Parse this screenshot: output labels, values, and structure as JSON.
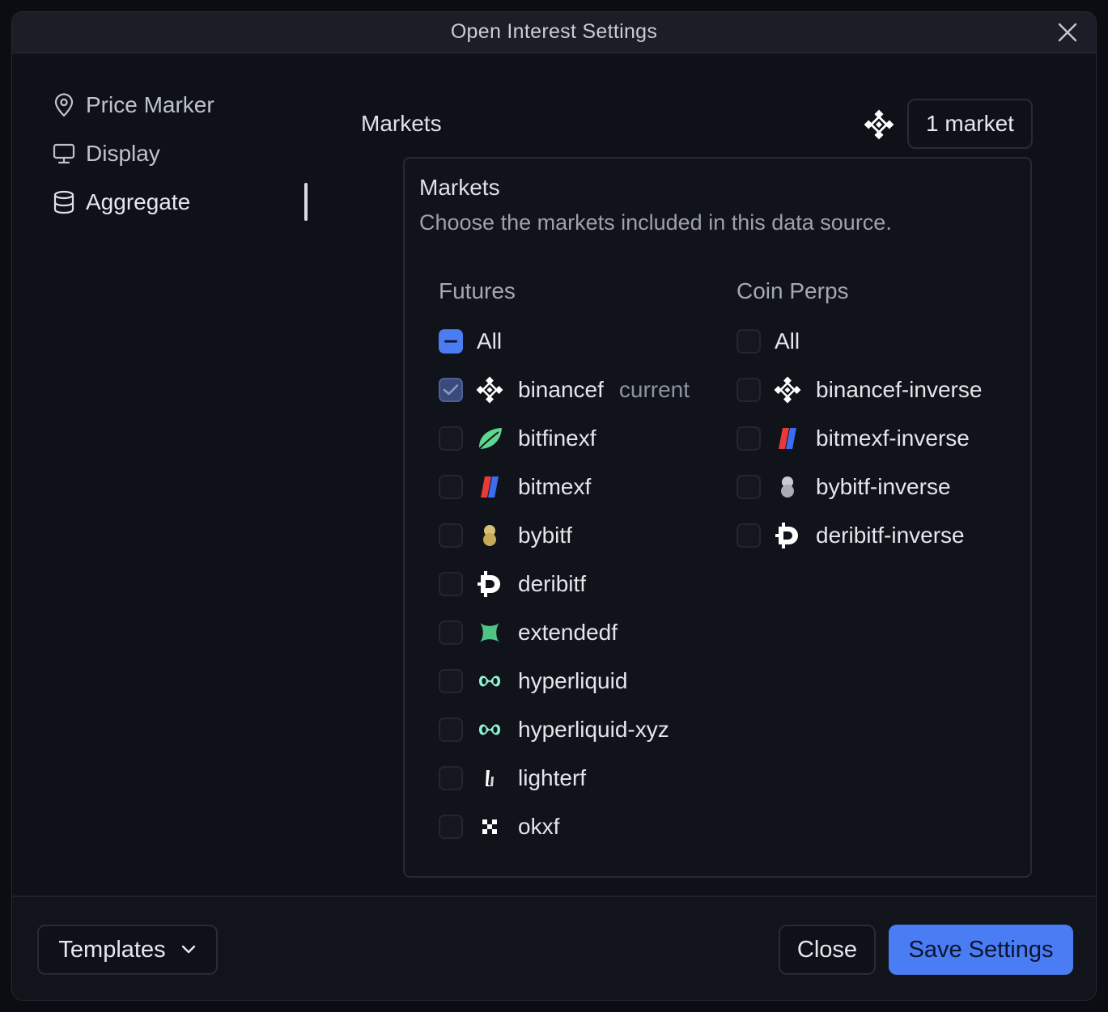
{
  "dialog": {
    "title": "Open Interest Settings",
    "close_icon": "close-icon"
  },
  "sidebar": {
    "items": [
      {
        "label": "Price Marker",
        "icon": "map-pin-icon"
      },
      {
        "label": "Display",
        "icon": "monitor-icon"
      },
      {
        "label": "Aggregate",
        "icon": "database-icon",
        "active": true
      }
    ]
  },
  "markets": {
    "heading": "Markets",
    "selected_count_label": "1 market",
    "panel": {
      "title": "Markets",
      "subtitle": "Choose the markets included in this data source."
    },
    "futures": {
      "heading": "Futures",
      "all_label": "All",
      "all_state": "indeterminate",
      "items": [
        {
          "label": "binancef",
          "tag": "current",
          "checked": true,
          "icon": "binance-icon"
        },
        {
          "label": "bitfinexf",
          "checked": false,
          "icon": "bitfinex-leaf-icon"
        },
        {
          "label": "bitmexf",
          "checked": false,
          "icon": "bitmex-icon"
        },
        {
          "label": "bybitf",
          "checked": false,
          "icon": "bybit-icon"
        },
        {
          "label": "deribitf",
          "checked": false,
          "icon": "deribit-icon"
        },
        {
          "label": "extendedf",
          "checked": false,
          "icon": "extended-icon"
        },
        {
          "label": "hyperliquid",
          "checked": false,
          "icon": "hyperliquid-icon"
        },
        {
          "label": "hyperliquid-xyz",
          "checked": false,
          "icon": "hyperliquid-icon"
        },
        {
          "label": "lighterf",
          "checked": false,
          "icon": "lighter-icon"
        },
        {
          "label": "okxf",
          "checked": false,
          "icon": "okx-icon"
        }
      ]
    },
    "coin_perps": {
      "heading": "Coin Perps",
      "all_label": "All",
      "all_state": "unchecked",
      "items": [
        {
          "label": "binancef-inverse",
          "checked": false,
          "icon": "binance-icon"
        },
        {
          "label": "bitmexf-inverse",
          "checked": false,
          "icon": "bitmex-icon"
        },
        {
          "label": "bybitf-inverse",
          "checked": false,
          "icon": "bybit-icon"
        },
        {
          "label": "deribitf-inverse",
          "checked": false,
          "icon": "deribit-icon"
        }
      ]
    }
  },
  "footer": {
    "templates_label": "Templates",
    "close_label": "Close",
    "save_label": "Save Settings"
  },
  "colors": {
    "accent": "#4a7cf3",
    "background": "#0f1119",
    "panel": "#11131b"
  }
}
